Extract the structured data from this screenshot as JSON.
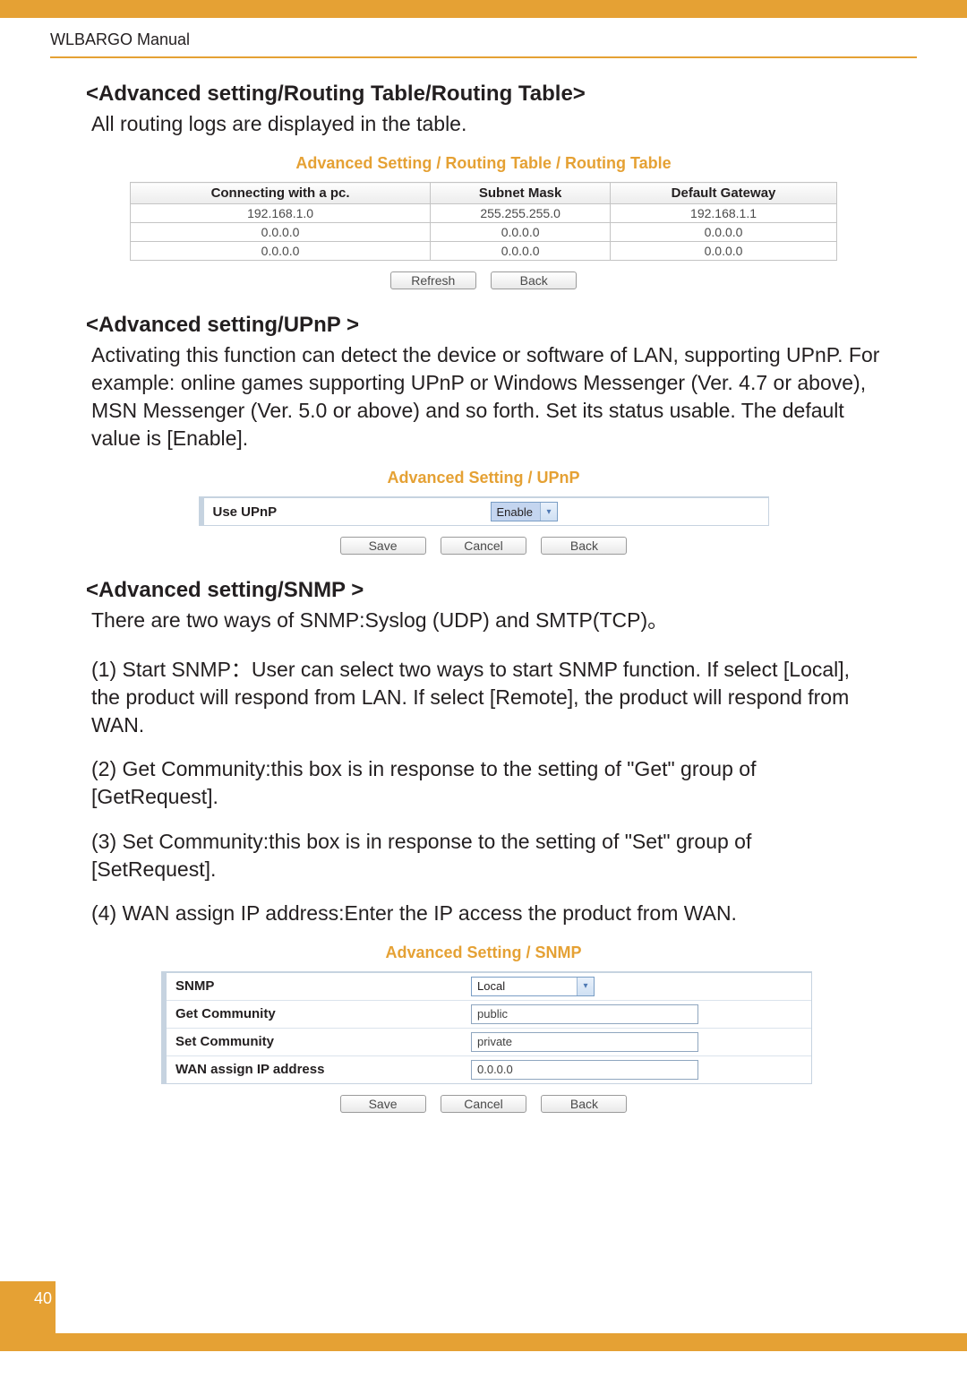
{
  "header": {
    "manual_title": "WLBARGO Manual",
    "page_number": "40"
  },
  "routing": {
    "heading": "<Advanced setting/Routing Table/Routing Table>",
    "body": "All routing logs are displayed in the table.",
    "panel_title": "Advanced Setting / Routing Table / Routing Table",
    "columns": [
      "Connecting with a pc.",
      "Subnet Mask",
      "Default Gateway"
    ],
    "rows": [
      [
        "192.168.1.0",
        "255.255.255.0",
        "192.168.1.1"
      ],
      [
        "0.0.0.0",
        "0.0.0.0",
        "0.0.0.0"
      ],
      [
        "0.0.0.0",
        "0.0.0.0",
        "0.0.0.0"
      ]
    ],
    "buttons": {
      "refresh": "Refresh",
      "back": "Back"
    }
  },
  "upnp": {
    "heading": "<Advanced setting/UPnP >",
    "body": "Activating this function can detect the device or software of LAN, supporting UPnP.  For example: online games supporting UPnP or Windows Messenger (Ver. 4.7 or above), MSN Messenger (Ver. 5.0 or above) and so forth.  Set its status usable.  The default value is [Enable].",
    "panel_title": "Advanced Setting / UPnP",
    "row_label": "Use UPnP",
    "select_value": "Enable",
    "buttons": {
      "save": "Save",
      "cancel": "Cancel",
      "back": "Back"
    }
  },
  "snmp": {
    "heading": "<Advanced setting/SNMP >",
    "intro": "There are two ways of SNMP:Syslog (UDP) and SMTP(TCP)。",
    "items": [
      "(1) Start SNMP：User can select two ways to start SNMP function. If select [Local], the product will respond from LAN. If select [Remote], the product will respond from WAN.",
      "(2) Get Community:this box is in response to the setting of \"Get\" group of [GetRequest].",
      "(3) Set Community:this box is in response to the setting of \"Set\" group of [SetRequest].",
      "(4) WAN assign IP address:Enter the IP access the product from WAN."
    ],
    "panel_title": "Advanced Setting / SNMP",
    "rows": [
      {
        "label": "SNMP",
        "type": "select",
        "value": "Local"
      },
      {
        "label": "Get Community",
        "type": "text",
        "value": "public"
      },
      {
        "label": "Set Community",
        "type": "text",
        "value": "private"
      },
      {
        "label": "WAN assign IP address",
        "type": "text",
        "value": "0.0.0.0"
      }
    ],
    "buttons": {
      "save": "Save",
      "cancel": "Cancel",
      "back": "Back"
    }
  }
}
